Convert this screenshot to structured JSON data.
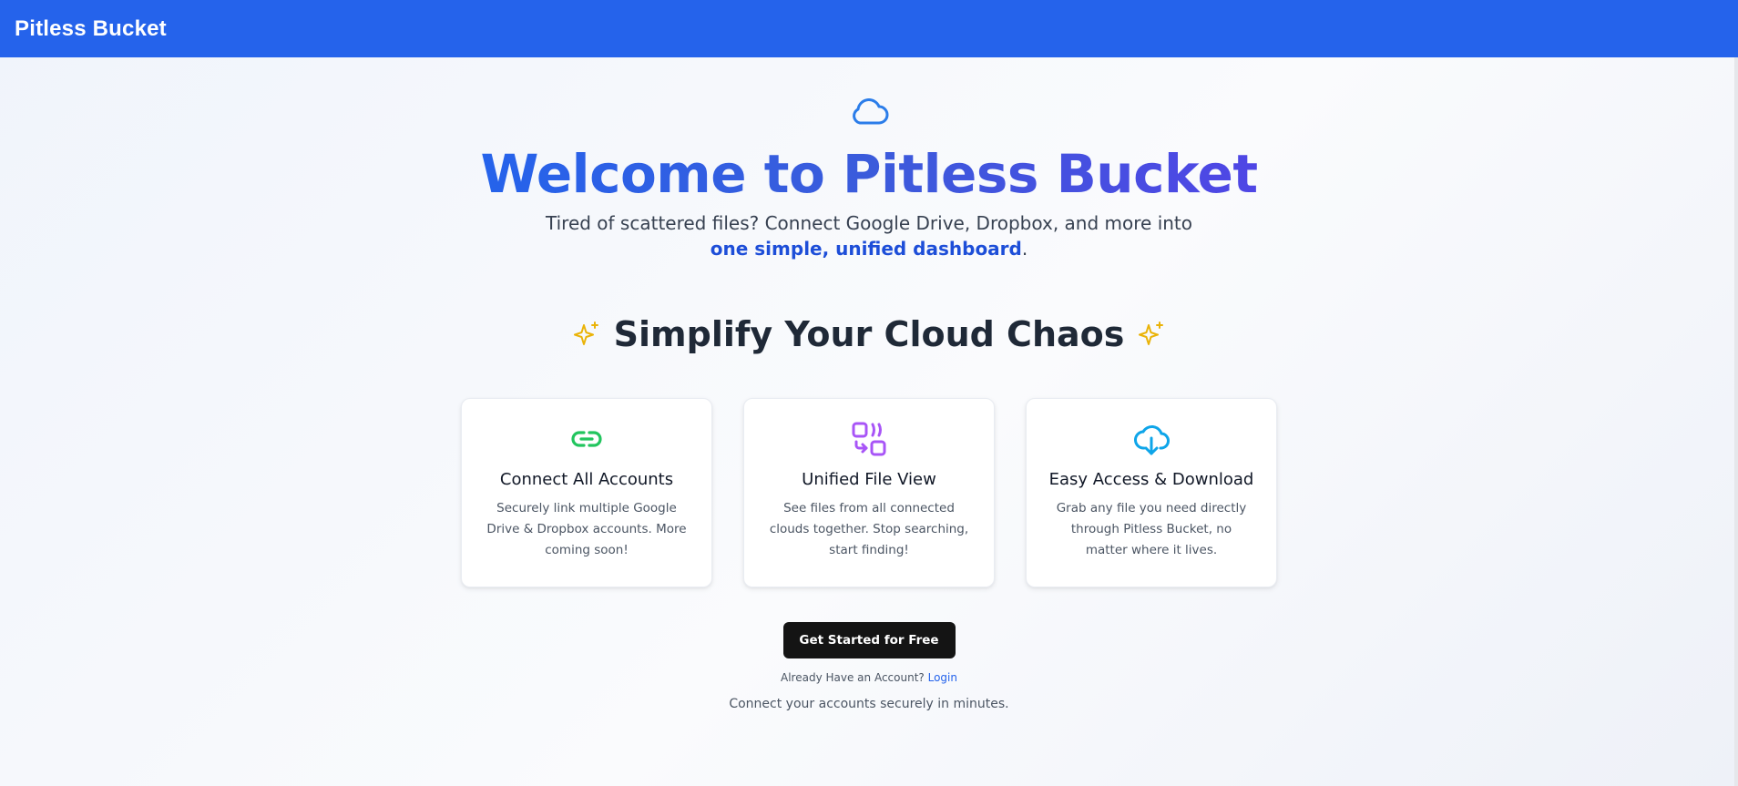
{
  "header": {
    "brand": "Pitless Bucket"
  },
  "hero": {
    "icon": "cloud-icon",
    "title": "Welcome to Pitless Bucket",
    "subtitle_before": "Tired of scattered files? Connect Google Drive, Dropbox, and more into ",
    "subtitle_highlight": "one simple, unified dashboard",
    "subtitle_after": "."
  },
  "features": {
    "heading": "Simplify Your Cloud Chaos",
    "sparkle_icon": "sparkles-icon",
    "cards": [
      {
        "icon": "link-icon",
        "title": "Connect All Accounts",
        "description": "Securely link multiple Google Drive & Dropbox accounts. More coming soon!"
      },
      {
        "icon": "unified-view-icon",
        "title": "Unified File View",
        "description": "See files from all connected clouds together. Stop searching, start finding!"
      },
      {
        "icon": "cloud-download-icon",
        "title": "Easy Access & Download",
        "description": "Grab any file you need directly through Pitless Bucket, no matter where it lives."
      }
    ]
  },
  "cta": {
    "button_label": "Get Started for Free",
    "login_prompt": "Already Have an Account?",
    "login_link": "Login",
    "tagline": "Connect your accounts securely in minutes."
  },
  "colors": {
    "navbar": "#2563eb",
    "title_gradient_start": "#2563eb",
    "title_gradient_end": "#4f46e5",
    "link_icon": "#22c55e",
    "unified_icon": "#a855f7",
    "download_icon": "#0ea5e9",
    "sparkle": "#eab308",
    "cta_button": "#141414"
  }
}
